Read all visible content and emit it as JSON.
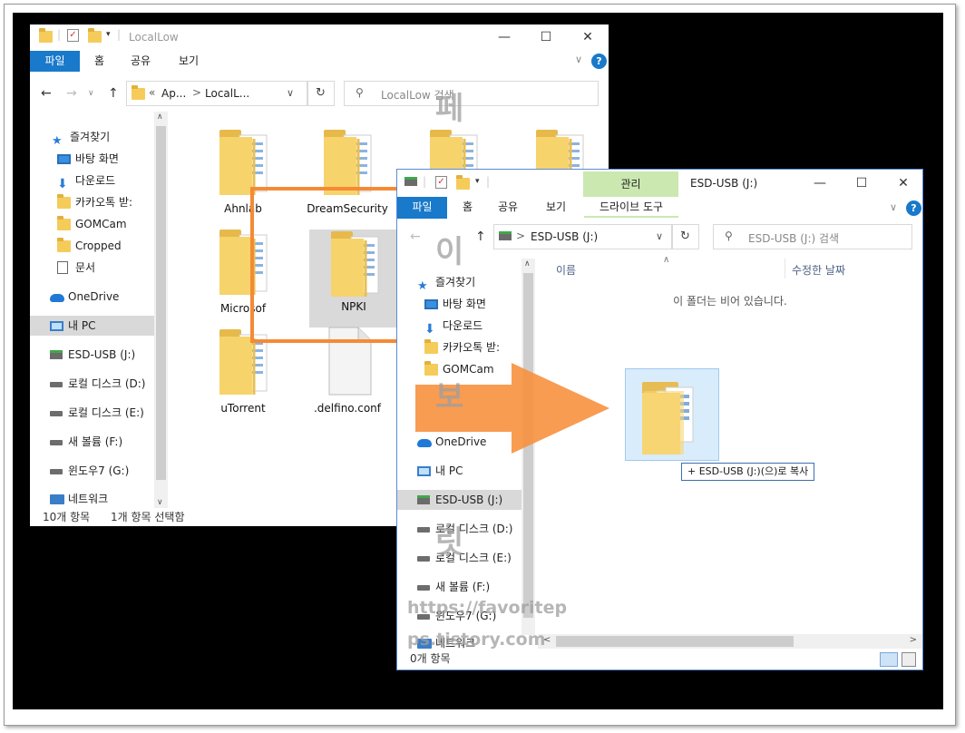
{
  "colors": {
    "accent": "#1979ca",
    "manage_tab": "#cbe8b0",
    "highlight_orange": "#f58a35",
    "arrow_orange": "#f7913f"
  },
  "win1": {
    "title": "LocalLow",
    "tabs": [
      "파일",
      "홈",
      "공유",
      "보기"
    ],
    "address": {
      "prefix": "«",
      "part1": "Ap...",
      "sep": ">",
      "part2": "LocalL..."
    },
    "search_placeholder": "LocalLow 검색",
    "nav": [
      {
        "label": "즐겨찾기",
        "icon": "star-icon"
      },
      {
        "label": "바탕 화면",
        "icon": "desktop-icon",
        "pinned": true
      },
      {
        "label": "다운로드",
        "icon": "download-icon",
        "pinned": true
      },
      {
        "label": "카카오톡 받:",
        "icon": "folder-icon",
        "pinned": true
      },
      {
        "label": "GOMCam",
        "icon": "folder-icon",
        "pinned": true
      },
      {
        "label": "Cropped",
        "icon": "folder-icon",
        "pinned": true
      },
      {
        "label": "문서",
        "icon": "document-icon",
        "pinned": true
      },
      {
        "label": "OneDrive",
        "icon": "onedrive-icon"
      },
      {
        "label": "내 PC",
        "icon": "pc-icon",
        "selected": true
      },
      {
        "label": "ESD-USB (J:)",
        "icon": "usb-drive-icon"
      },
      {
        "label": "로컬 디스크 (D:)",
        "icon": "drive-icon"
      },
      {
        "label": "로컬 디스크 (E:)",
        "icon": "drive-icon"
      },
      {
        "label": "새 볼륨 (F:)",
        "icon": "drive-icon"
      },
      {
        "label": "윈도우7 (G:)",
        "icon": "drive-icon"
      },
      {
        "label": "네트워크",
        "icon": "network-icon"
      }
    ],
    "files": [
      {
        "name": "Ahnlab"
      },
      {
        "name": "DreamSecurity"
      },
      {
        "name": ""
      },
      {
        "name": ""
      },
      {
        "name": "Microsof"
      },
      {
        "name": "NPKI",
        "selected": true
      },
      {
        "name": "uTorrent"
      },
      {
        "name": ".delfino.conf"
      }
    ],
    "status": {
      "count": "10개 항목",
      "selected": "1개 항목 선택함"
    }
  },
  "win2": {
    "title": "ESD-USB (J:)",
    "context_tab": "관리",
    "tabs": [
      "파일",
      "홈",
      "공유",
      "보기"
    ],
    "context_subtab": "드라이브 도구",
    "address": "ESD-USB (J:)",
    "search_placeholder": "ESD-USB (J:) 검색",
    "columns": [
      "이름",
      "수정한 날짜"
    ],
    "empty_message": "이 폴더는 비어 있습니다.",
    "nav": [
      {
        "label": "즐겨찾기",
        "icon": "star-icon"
      },
      {
        "label": "바탕 화면",
        "icon": "desktop-icon",
        "pinned": true
      },
      {
        "label": "다운로드",
        "icon": "download-icon",
        "pinned": true
      },
      {
        "label": "카카오톡 받:",
        "icon": "folder-icon",
        "pinned": true
      },
      {
        "label": "GOMCam",
        "icon": "folder-icon",
        "pinned": true
      },
      {
        "label": "OneDrive",
        "icon": "onedrive-icon"
      },
      {
        "label": "내 PC",
        "icon": "pc-icon"
      },
      {
        "label": "ESD-USB (J:)",
        "icon": "usb-drive-icon",
        "selected": true
      },
      {
        "label": "로컬 디스크 (D:)",
        "icon": "drive-icon"
      },
      {
        "label": "로컬 디스크 (E:)",
        "icon": "drive-icon"
      },
      {
        "label": "새 볼륨 (F:)",
        "icon": "drive-icon"
      },
      {
        "label": "윈도우7 (G:)",
        "icon": "drive-icon"
      },
      {
        "label": "네트워크",
        "icon": "network-icon"
      }
    ],
    "drag_tooltip": "+ ESD-USB (J:)(으)로 복사",
    "status": {
      "count": "0개 항목"
    }
  },
  "watermark": {
    "chars": [
      "페",
      "이",
      "보",
      "릿"
    ],
    "url1": "https://favoritep",
    "url2": "ps.tistory.com"
  }
}
